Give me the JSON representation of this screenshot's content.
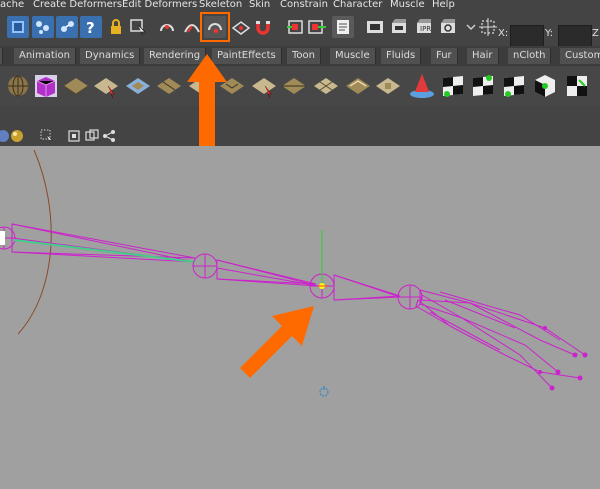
{
  "menu": {
    "items": [
      "ache",
      "Create Deformers",
      "Edit Deformers",
      "Skeleton",
      "Skin",
      "Constrain",
      "Character",
      "Muscle",
      "Help"
    ]
  },
  "statusline": {
    "x_label": "X:",
    "y_label": "Y:",
    "z_label": "Z:",
    "icons": [
      "move-icon",
      "scale-icon",
      "rotate-icon",
      "help-icon",
      "lock-icon",
      "selection-mask-icon",
      "snap-curve-icon",
      "snap-magnet-icon",
      "snap-point-icon",
      "snap-view-plane-icon",
      "make-live-icon",
      "input-ops-icon",
      "output-ops-icon",
      "construction-history-icon",
      "render-view-icon",
      "render-icon",
      "ipr-render-icon",
      "render-settings-icon",
      "transform-field-icon"
    ]
  },
  "shelf": {
    "tabs": [
      "Animation",
      "Dynamics",
      "Rendering",
      "PaintEffects",
      "Toon",
      "Muscle",
      "Fluids",
      "Fur",
      "Hair",
      "nCloth",
      "Custom"
    ],
    "icons": [
      "sphere-icon",
      "cube-icon",
      "plane-arrow-icon",
      "plane-icon",
      "plane-icon",
      "plane-icon",
      "plane-icon",
      "plane-icon",
      "plane-icon",
      "plane-icon",
      "plane-icon",
      "plane-icon",
      "plane-icon",
      "plane-icon",
      "cone-icon",
      "checker-icon",
      "checker-icon",
      "checker-icon",
      "checker-icon",
      "checker-icon"
    ]
  },
  "panel_tools": [
    "sphere-shade-icon",
    "material-ball-icon",
    "select-icon",
    "isolate-icon",
    "frame-icon",
    "share-icon"
  ],
  "annotation": {
    "color": "#ff6a00"
  },
  "colors": {
    "joint": "#cc22cc",
    "selected_bone": "#44cc88",
    "manipulator_y": "#33cc33",
    "manipulator_center": "#ffff00",
    "curve": "#8a4a2a"
  }
}
